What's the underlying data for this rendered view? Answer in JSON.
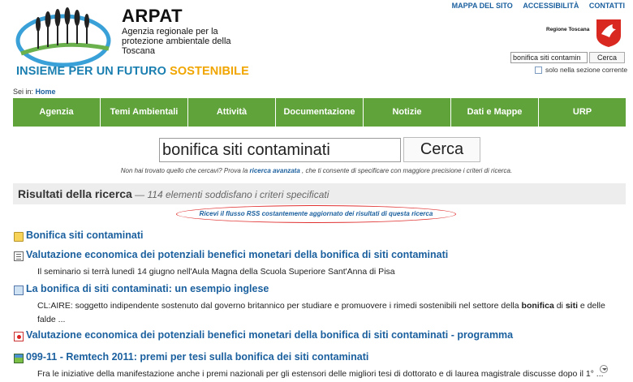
{
  "header": {
    "org_name": "ARPAT",
    "org_sub": "Agenzia regionale per la protezione ambientale della Toscana",
    "tagline_part1": "INSIEME PER UN FUTURO ",
    "tagline_part2": "SOSTENIBILE",
    "region_label": "Regione Toscana",
    "top_links": [
      "MAPPA DEL SITO",
      "ACCESSIBILITÀ",
      "CONTATTI"
    ],
    "search_value": "bonifica siti contamin",
    "search_button": "Cerca",
    "checkbox_label": "solo nella sezione corrente"
  },
  "breadcrumb": {
    "prefix": "Sei in:",
    "home": "Home"
  },
  "nav": [
    "Agenzia",
    "Temi Ambientali",
    "Attività",
    "Documentazione",
    "Notizie",
    "Dati e Mappe",
    "URP"
  ],
  "search": {
    "value": "bonifica siti contaminati",
    "button": "Cerca",
    "hint_before": "Non hai trovato quello che cercavi? Prova la ",
    "hint_link": "ricerca avanzata",
    "hint_after": " , che ti consente di specificare con maggiore precisione i criteri di ricerca."
  },
  "results": {
    "title": "Risultati della ricerca",
    "count": " — 114 elementi soddisfano i criteri specificati",
    "rss": "Ricevi il flusso RSS costantemente aggiornato dei risultati di questa ricerca",
    "items": [
      {
        "icon": "folder-icon",
        "title": "Bonifica siti contaminati",
        "desc": ""
      },
      {
        "icon": "document-icon",
        "title": "Valutazione economica dei potenziali benefici monetari della bonifica di siti contaminati",
        "desc": "Il seminario si terrà lunedì 14 giugno nell'Aula Magna della Scuola Superiore Sant'Anna di Pisa"
      },
      {
        "icon": "news-icon",
        "title": "La bonifica di siti contaminati: un esempio inglese",
        "desc_before": "CL:AIRE: soggetto indipendente sostenuto dal governo britannico per studiare e promuovere i rimedi sostenibili nel settore della ",
        "desc_b1": "bonifica",
        "desc_mid": " di ",
        "desc_b2": "siti",
        "desc_after": " e delle falde ..."
      },
      {
        "icon": "pdf-icon",
        "title": "Valutazione economica dei potenziali benefici monetari della bonifica di siti contaminati - programma",
        "desc": ""
      },
      {
        "icon": "event-icon",
        "title": "099-11 - Remtech 2011: premi per tesi sulla bonifica dei siti contaminati",
        "desc": "Fra le iniziative della manifestazione anche i premi nazionali per gli estensori delle migliori tesi di dottorato e di laurea magistrale discusse dopo il 1° ..."
      }
    ]
  },
  "colors": {
    "nav_green": "#5fa33a",
    "link_blue": "#1a5f9e",
    "tagline_blue": "#1a7fb0",
    "tagline_orange": "#f0a500",
    "rss_ellipse": "#e03030"
  }
}
